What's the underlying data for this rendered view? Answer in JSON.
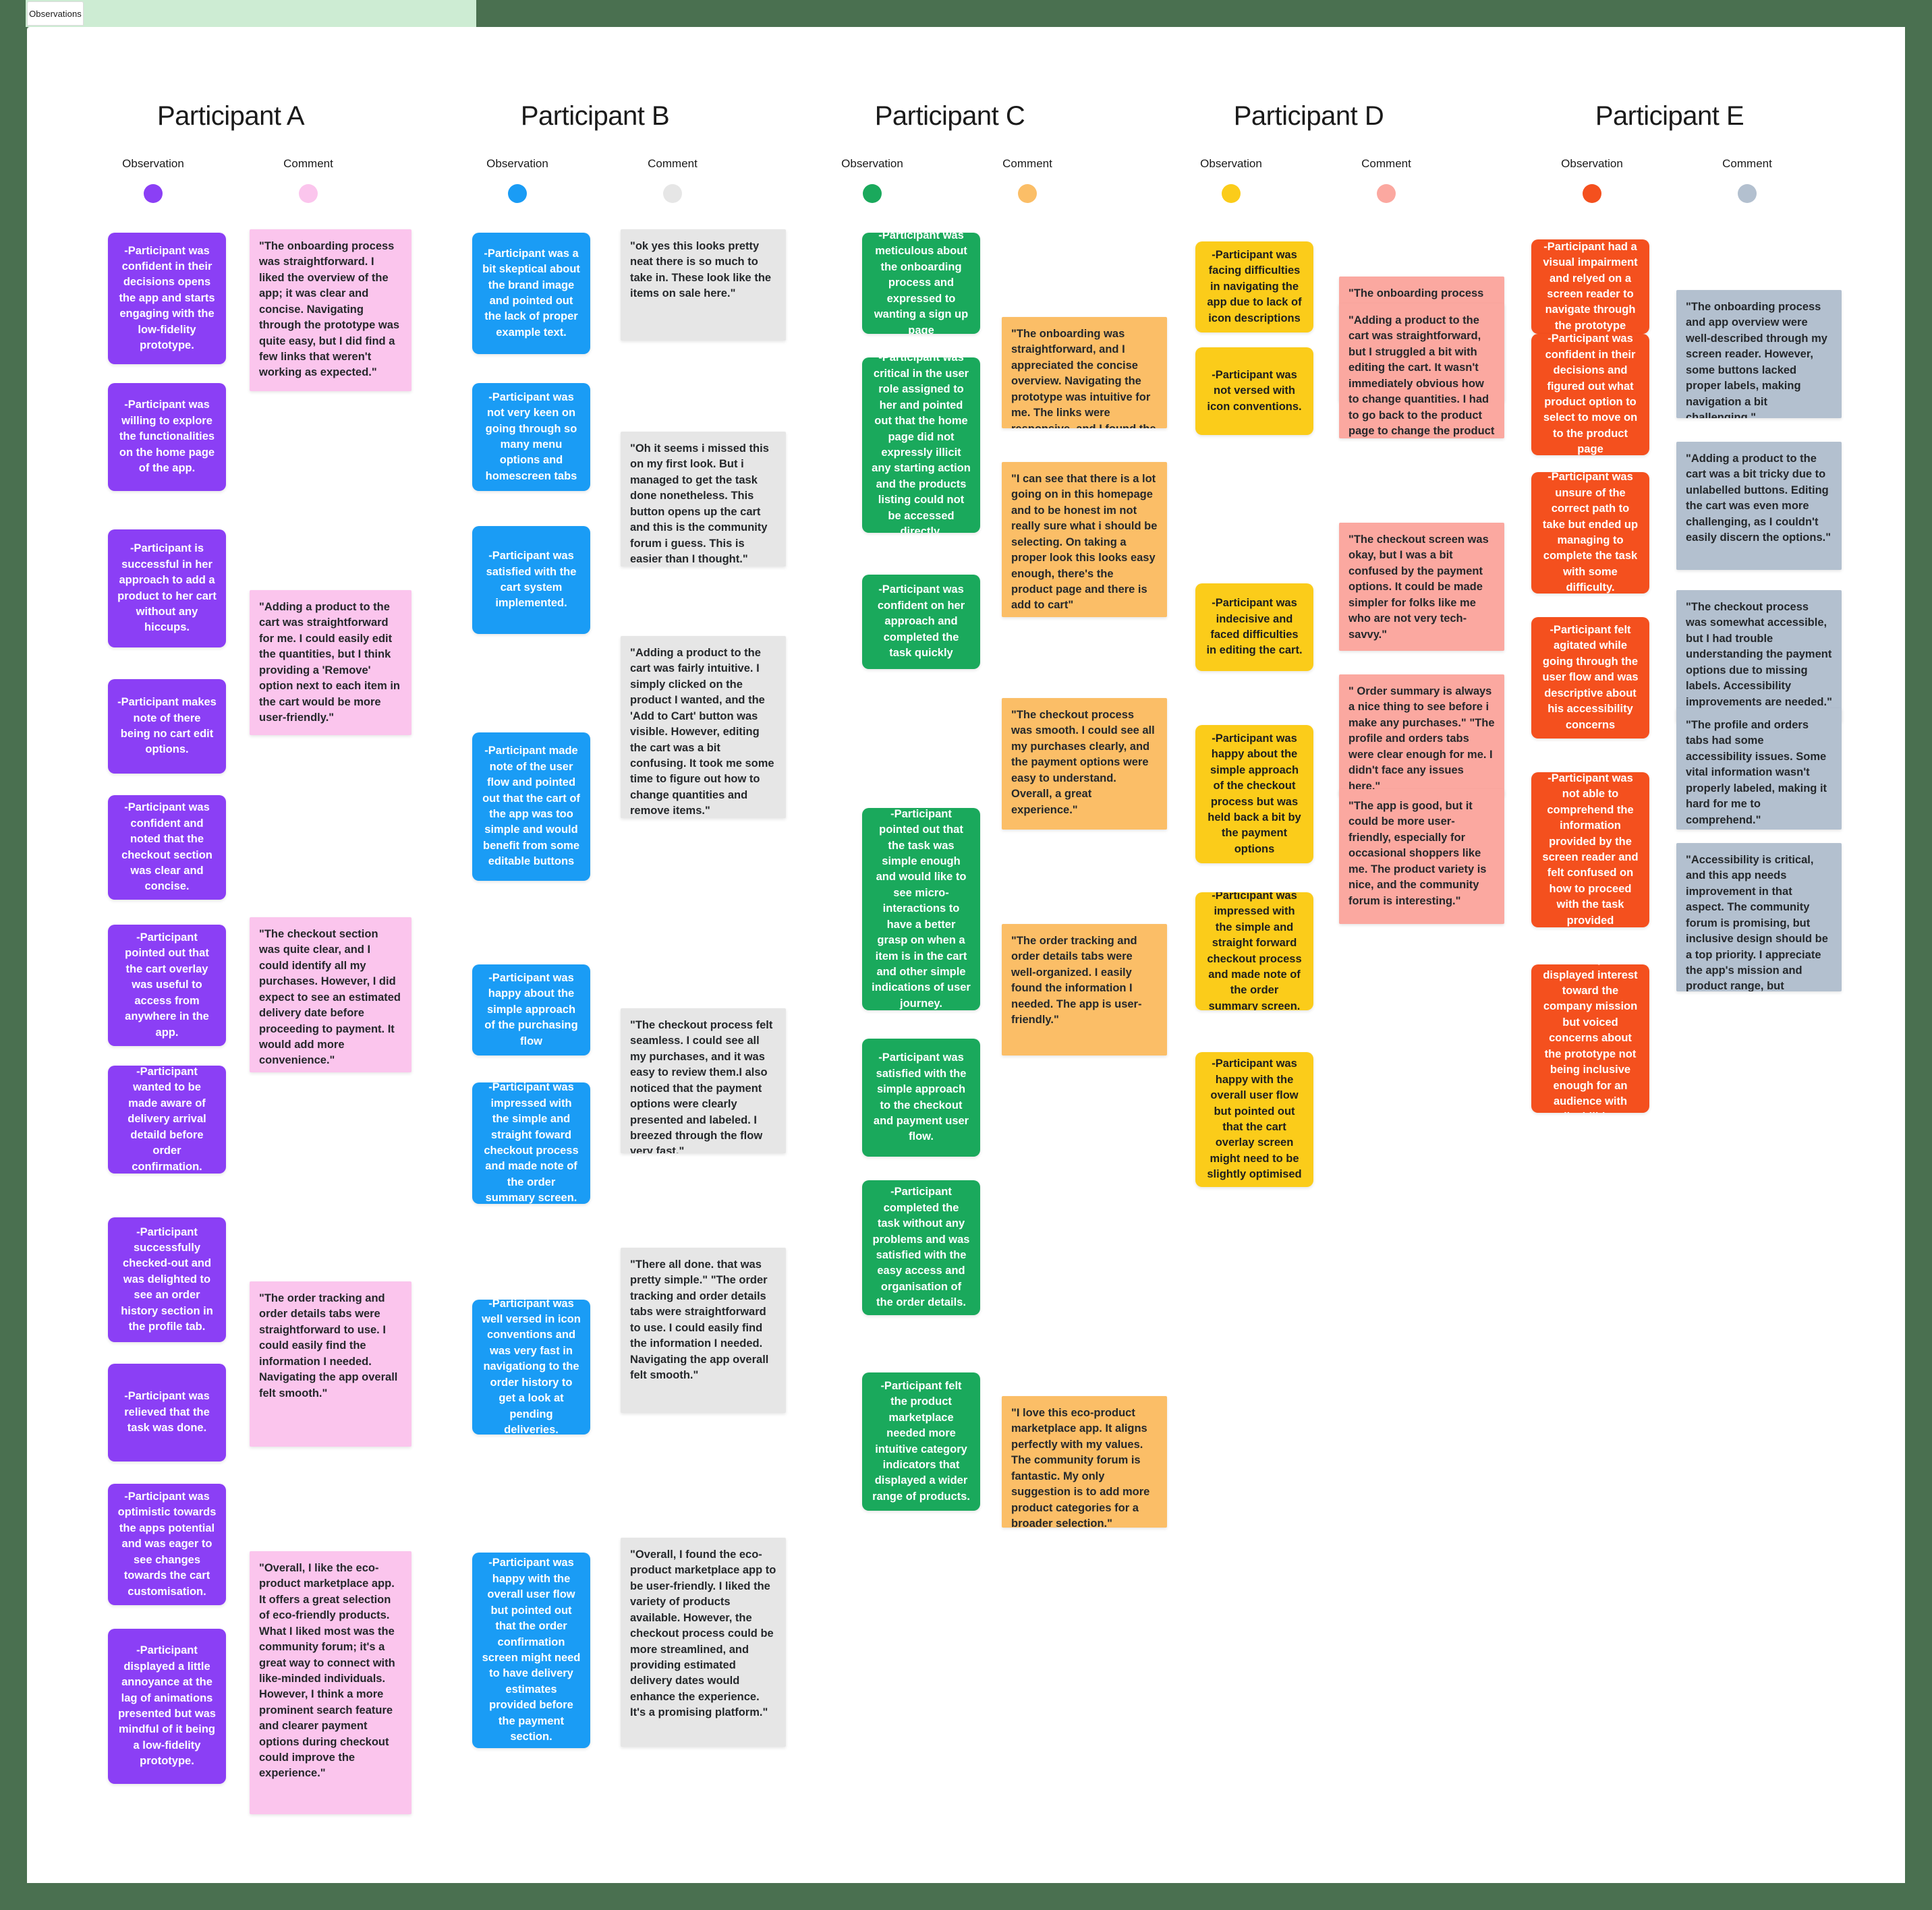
{
  "tab": {
    "label": "Observations"
  },
  "colors": {
    "A_obs": "#8b3ff5",
    "A_cmt": "#fbc5ed",
    "B_obs": "#1a9cf5",
    "B_cmt": "#e6e6e6",
    "C_obs": "#1aa95c",
    "C_cmt": "#fbbe67",
    "D_obs": "#fbcc1a",
    "D_cmt": "#fba8a0",
    "E_obs": "#f4501e",
    "E_cmt": "#b3c0cf"
  },
  "legend": {
    "observation": "Observation",
    "comment": "Comment"
  },
  "participants": [
    {
      "title": "Participant A",
      "observations": [
        "-Participant was confident in their decisions opens the app and starts engaging with the low-fidelity prototype.",
        "-Participant was willing to explore the functionalities on the home page of the app.",
        "-Participant is successful in her approach to add a product to her cart without any hiccups.",
        "-Participant makes note of there being no cart edit options.",
        "-Participant was confident and noted that the checkout section was clear and concise.",
        "-Participant pointed out that the cart overlay was useful to access from anywhere in the app.",
        "-Participant wanted to be made aware of delivery arrival detaild before order confirmation.",
        "-Participant successfully checked-out and was delighted to see an order history section in the profile tab.",
        "-Participant was relieved that the task was done.",
        "-Participant was optimistic towards the apps potential and was eager to see changes towards the cart customisation.",
        "-Participant displayed a little annoyance at the lag of animations presented but was mindful of it being a low-fidelity prototype."
      ],
      "comments": [
        "\"The onboarding process was straightforward. I liked the overview of the app; it was clear and concise. Navigating through the prototype was quite easy, but I did find a few links that weren't working as expected.\"",
        "\"Adding a product to the cart was straightforward for me. I could easily edit the quantities, but I think providing a 'Remove' option next to each item in the cart would be more user-friendly.\"",
        "\"The checkout section was quite clear, and I could identify all my purchases. However, I did expect to see an estimated delivery date before proceeding to payment. It would add more convenience.\"",
        "\"The order tracking and order details tabs were straightforward to use. I could easily find the information I needed. Navigating the app overall felt smooth.\"",
        "\"Overall, I like the eco-product marketplace app. It offers a great selection of eco-friendly products. What I liked most was the community forum; it's a great way to connect with like-minded individuals. However, I think a more prominent search feature and clearer payment options during checkout could improve the experience.\""
      ]
    },
    {
      "title": "Participant B",
      "observations": [
        "-Participant was a bit skeptical about the brand image and pointed out the lack of proper example text.",
        "-Participant was not very keen on going through so many menu options and homescreen tabs",
        "-Participant was satisfied with the cart system implemented.",
        "-Participant made note of the user flow and pointed out that the cart of the app was too simple and would benefit from some editable buttons",
        "-Participant was happy about the simple approach of the purchasing flow",
        "-Participant was impressed with the simple and straight foward checkout process and made note of the order summary screen.",
        "-Participant was well versed in icon conventions and was very fast in navigationg to the order history to get a look at pending deliveries.",
        "-Participant was happy with the overall user flow but pointed out that the order confirmation screen might need to have delivery estimates provided before the payment section."
      ],
      "comments": [
        "\"ok yes this looks pretty neat there is so much to take in. These look like the items on sale here.\"",
        "\"Oh it seems i missed this on my first look. But i managed to get the task done nonetheless. This button opens up the cart and this is the community forum i guess. This is easier than I thought.\"",
        " \"Adding a product to the cart was fairly intuitive. I simply clicked on the product I wanted, and the 'Add to Cart' button was visible. However, editing the cart was a bit confusing. It took me some time to figure out how to change quantities and remove items.\"",
        "\"The checkout process felt seamless. I could see all my purchases, and it was easy to review them.I also noticed that the payment options were clearly presented and labeled. I breezed through the flow very fast.\"",
        "\"There all done. that was pretty simple.\"\n\"The order tracking and order details tabs were straightforward to use. I could easily find the information I needed. Navigating the app overall felt smooth.\"",
        "\"Overall, I found the eco-product marketplace app to be user-friendly. I liked the variety of products available. However, the checkout process could be more streamlined, and providing estimated delivery dates would enhance the experience. It's a promising platform.\""
      ]
    },
    {
      "title": "Participant C",
      "observations": [
        "-Participant was meticulous about the onboarding process and expressed to wanting a sign up page",
        "-Participant was critical in the user role assigned to her and pointed out that the home page did not expressly illicit any starting action and the products listing could not be accessed directly.",
        "-Participant was confident on her approach and completed the task quickly",
        "-Participant pointed out that the task was simple enough and would like to see micro-interactions to have a better grasp on when a item is in the cart and other simple indications of user journey.",
        "-Participant was satisfied with the simple approach to the checkout and payment user flow.",
        "-Participant completed the task without any problems and was satisfied with the easy access and organisation of the order details.",
        "-Participant felt the product marketplace needed more intuitive category indicators that displayed a wider range of products."
      ],
      "comments": [
        "\"The onboarding was straightforward, and I appreciated the concise overview. Navigating the prototype was intuitive for me. The links were responsive, and I found the prototype engaging.\"",
        "\"I can see that there is a lot going on in this homepage and to be honest im not really sure what i should be selecting. On taking a proper look this looks easy enough, there's the product page and there is add to cart\"",
        "\"The checkout process was smooth. I could see all my purchases clearly, and the payment options were easy to understand. Overall, a great experience.\"",
        "\"The order tracking and order details tabs were well-organized. I easily found the information I needed. The app is user-friendly.\"",
        "\"I love this eco-product marketplace app. It aligns perfectly with my values. The community forum is fantastic. My only suggestion is to add more product categories for a broader selection.\""
      ]
    },
    {
      "title": "Participant D",
      "observations": [
        "-Participant was facing difficulties in navigating the app due to lack of icon descriptions",
        "-Participant was not versed with icon conventions.",
        "-Participant was indecisive and faced difficulties in editing the cart.",
        "-Participant was happy about the simple approach of the checkout process but was held back a bit by the payment options",
        "-Participant was impressed with the simple and straight forward checkout process and made note of the order summary screen.",
        "-Participant was happy with the overall user flow but pointed out that the cart overlay screen might need to be slightly optimised"
      ],
      "comments": [
        " \"The onboarding process was easy to follow, and the app overview was clear. However, I found some of the icon a bit ambiguous and difficult to discern the function of on my mobile screen.\"",
        "\"Adding a product to the cart was straightforward, but I struggled a bit with editing the cart. It wasn't immediately obvious how to change quantities. I had to go back to the product page to change the product quantities\"",
        "\"The checkout screen was okay, but I was a bit confused by the payment options. It could be made simpler for folks like me who are not very tech-savvy.\"",
        "\" Order summary is always a nice thing to see before i make any purchases.\"\n\"The profile and orders tabs were clear enough for me. I didn't face any issues here.\"",
        "\"The app is good, but it could be more user-friendly, especially for occasional shoppers like me. The product variety is nice, and the community forum is interesting.\""
      ]
    },
    {
      "title": "Participant E",
      "observations": [
        "-Participant had a visual impairment and relyed on a screen reader to navigate through the prototype",
        "-Participant was confident in their decisions and figured out what product option to select to move on to the product page",
        "-Participant was unsure of the correct path to take but ended up managing to complete the task with some difficulty.",
        "-Participant felt agitated while going through the user flow and was descriptive about his accessibility concerns",
        "-Participant was not able to comprehend the information provided by the screen reader and felt confused on how to proceed with the task provided",
        "-Participant displayed interest toward the company mission but voiced concerns about the prototype not being inclusive enough for an audience with disabilities."
      ],
      "comments": [
        " \"The onboarding process and app overview were well-described through my screen reader. However, some buttons lacked proper labels, making navigation a bit challenging.\"",
        "\"Adding a product to the cart was a bit tricky due to unlabelled buttons. Editing the cart was even more challenging, as I couldn't easily discern the options.\"",
        "\"The checkout process was somewhat accessible, but I had trouble understanding the payment options due to missing labels. Accessibility improvements are needed.\"",
        "\"The profile and orders tabs had some accessibility issues. Some vital information wasn't properly labeled, making it hard for me to comprehend.\"",
        "\"Accessibility is critical, and this app needs improvement in that aspect. The community forum is promising, but inclusive design should be a top priority. I appreciate the app's mission and product range, but accessibility is key for all users.\""
      ]
    }
  ]
}
